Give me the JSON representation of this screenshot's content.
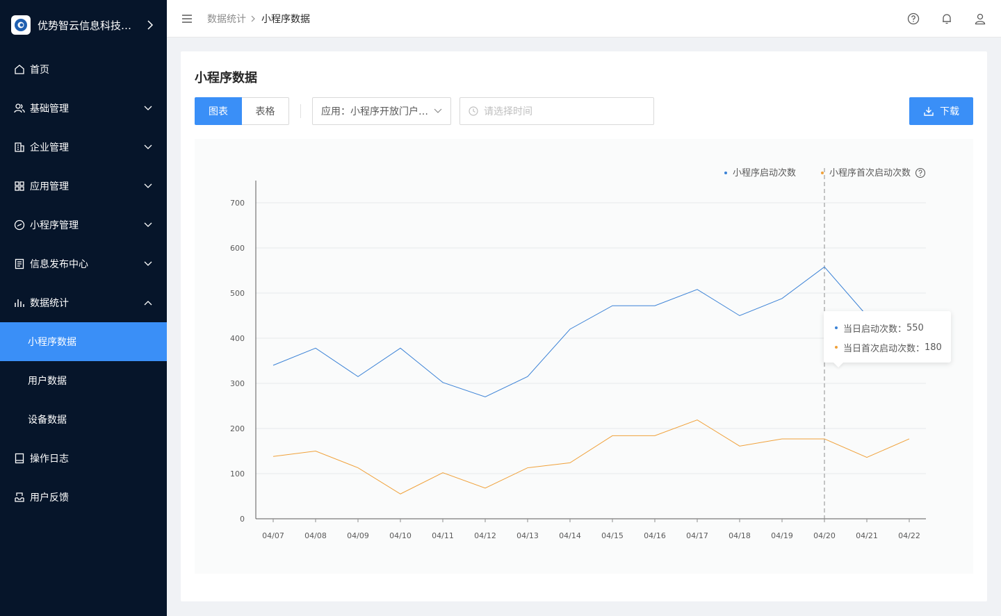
{
  "brand": {
    "name": "优势智云信息科技有限公司",
    "logo_icon": "brand-logo-icon"
  },
  "sidebar": {
    "items": [
      {
        "label": "首页",
        "icon": "home-icon",
        "has_children": false
      },
      {
        "label": "基础管理",
        "icon": "users-icon",
        "has_children": true,
        "expanded": false
      },
      {
        "label": "企业管理",
        "icon": "building-icon",
        "has_children": true,
        "expanded": false
      },
      {
        "label": "应用管理",
        "icon": "grid-icon",
        "has_children": true,
        "expanded": false
      },
      {
        "label": "小程序管理",
        "icon": "miniprogram-icon",
        "has_children": true,
        "expanded": false
      },
      {
        "label": "信息发布中心",
        "icon": "document-icon",
        "has_children": true,
        "expanded": false
      },
      {
        "label": "数据统计",
        "icon": "bar-chart-icon",
        "has_children": true,
        "expanded": true,
        "children": [
          {
            "label": "小程序数据",
            "active": true
          },
          {
            "label": "用户数据",
            "active": false
          },
          {
            "label": "设备数据",
            "active": false
          }
        ]
      },
      {
        "label": "操作日志",
        "icon": "log-book-icon",
        "has_children": false
      },
      {
        "label": "用户反馈",
        "icon": "inbox-icon",
        "has_children": false
      }
    ]
  },
  "header": {
    "breadcrumb": [
      "数据统计",
      "小程序数据"
    ]
  },
  "main": {
    "title": "小程序数据",
    "view_tabs": [
      "图表",
      "表格"
    ],
    "active_tab": 0,
    "app_select": {
      "value": "应用：小程序开放门户平台"
    },
    "date_picker": {
      "placeholder": "请选择时间"
    },
    "download_label": "下载"
  },
  "colors": {
    "accent": "#3a8ff7",
    "series1": "#3b82d6",
    "series2": "#f0a13a",
    "sidebar_bg": "#06152a"
  },
  "chart_data": {
    "type": "line",
    "categories": [
      "04/07",
      "04/08",
      "04/09",
      "04/10",
      "04/11",
      "04/12",
      "04/13",
      "04/14",
      "04/15",
      "04/16",
      "04/17",
      "04/18",
      "04/19",
      "04/20",
      "04/21",
      "04/22"
    ],
    "series": [
      {
        "name": "小程序启动次数",
        "values": [
          340,
          378,
          315,
          378,
          302,
          270,
          315,
          420,
          472,
          472,
          508,
          450,
          488,
          558,
          450,
          null
        ]
      },
      {
        "name": "小程序首次启动次数",
        "values": [
          138,
          150,
          113,
          55,
          102,
          68,
          113,
          124,
          184,
          184,
          219,
          161,
          177,
          177,
          136,
          177
        ]
      }
    ],
    "ylim": [
      0,
      700
    ],
    "yticks": [
      0,
      100,
      200,
      300,
      400,
      500,
      600,
      700
    ],
    "grid": true,
    "legend": "top-right",
    "highlight_index": 13,
    "tooltip": {
      "rows": [
        {
          "label": "当日启动次数：",
          "value": "550"
        },
        {
          "label": "当日首次启动次数：",
          "value": "180"
        }
      ]
    }
  }
}
